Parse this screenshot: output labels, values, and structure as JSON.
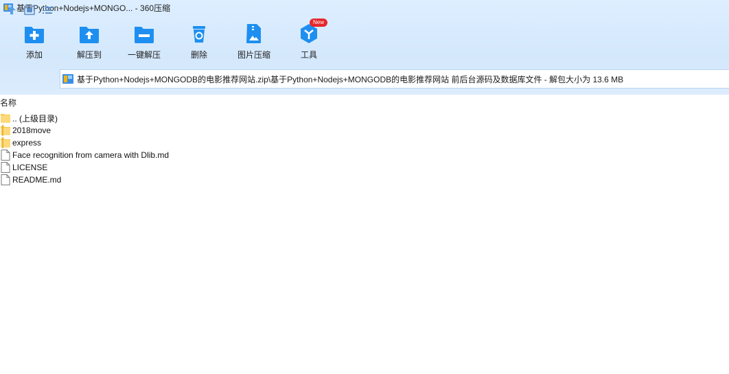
{
  "window": {
    "title": "基于Python+Nodejs+MONGO... - 360压缩"
  },
  "toolbar": {
    "items": [
      {
        "label": "添加",
        "icon": "add-icon"
      },
      {
        "label": "解压到",
        "icon": "extract-to-icon"
      },
      {
        "label": "一键解压",
        "icon": "one-click-extract-icon"
      },
      {
        "label": "删除",
        "icon": "delete-icon"
      },
      {
        "label": "图片压缩",
        "icon": "image-compress-icon"
      },
      {
        "label": "工具",
        "icon": "tools-icon",
        "badge": "New"
      }
    ]
  },
  "nav": {
    "address": "基于Python+Nodejs+MONGODB的电影推荐网站.zip\\基于Python+Nodejs+MONGODB的电影推荐网站 前后台源码及数据库文件 - 解包大小为 13.6 MB"
  },
  "list": {
    "column_name": "名称",
    "items": [
      {
        "name": ".. (上级目录)",
        "type": "folder"
      },
      {
        "name": "2018move",
        "type": "folder"
      },
      {
        "name": "express",
        "type": "folder"
      },
      {
        "name": "Face recognition from camera with Dlib.md",
        "type": "file"
      },
      {
        "name": "LICENSE",
        "type": "file"
      },
      {
        "name": "README.md",
        "type": "file"
      }
    ]
  },
  "colors": {
    "accent": "#1e8ff0",
    "toolbar_bg": "#d6e9fc",
    "badge": "#e5262b",
    "folder": "#f5c84c"
  }
}
